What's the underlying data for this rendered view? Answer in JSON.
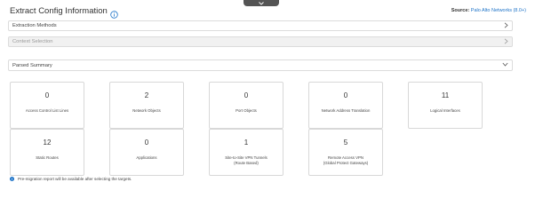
{
  "header": {
    "title": "Extract Config Information",
    "source_label": "Source:",
    "source_value": "Palo Alto Networks (8.0+)"
  },
  "sections": {
    "extraction_methods": "Extraction Methods",
    "context_selection": "Context Selection",
    "parsed_summary": "Parsed Summary"
  },
  "summary_cards": [
    {
      "value": "0",
      "label": "Access Control List Lines",
      "label2": ""
    },
    {
      "value": "2",
      "label": "Network Objects",
      "label2": ""
    },
    {
      "value": "0",
      "label": "Port Objects",
      "label2": ""
    },
    {
      "value": "0",
      "label": "Network Address Translation",
      "label2": ""
    },
    {
      "value": "11",
      "label": "Logical Interfaces",
      "label2": ""
    },
    {
      "value": "12",
      "label": "Static Routes",
      "label2": ""
    },
    {
      "value": "0",
      "label": "Applications",
      "label2": ""
    },
    {
      "value": "1",
      "label": "Site-to-Site VPN Tunnels",
      "label2": "(Route Based)"
    },
    {
      "value": "5",
      "label": "Remote Access VPN",
      "label2": "(Global Protect Gateways)"
    }
  ],
  "footer_note": "Pre-migration report will be available after selecting the targets.",
  "colors": {
    "accent": "#1f74c8",
    "border": "#d8d8d8",
    "disabled_bg": "#f1f1f1",
    "top_tab": "#545454"
  },
  "icons": {
    "title_info": "info-icon",
    "row_chevron": "chevron-right-icon",
    "summary_chevron": "chevron-down-icon",
    "top_tab": "chevron-down-icon",
    "note": "info-filled-icon"
  }
}
